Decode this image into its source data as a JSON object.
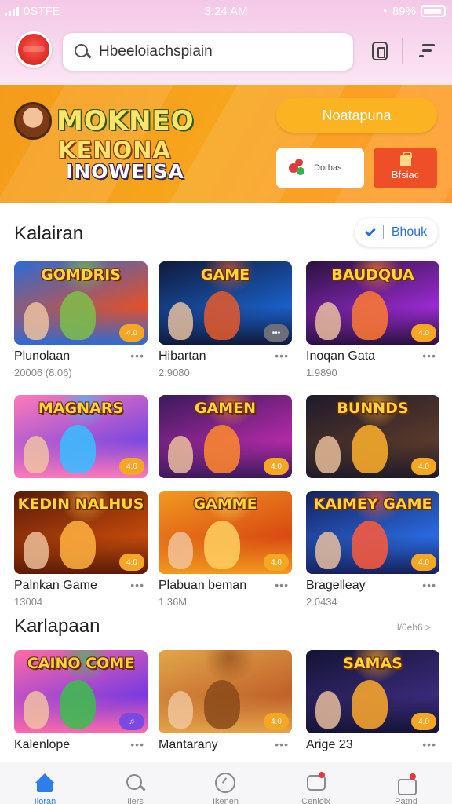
{
  "status_bar": {
    "carrier": "0STFE",
    "time": "3:24 AM",
    "battery": "89%"
  },
  "header": {
    "search": {
      "value": "Hbeeloiachspiain"
    }
  },
  "banner": {
    "title_line1": "MOKNEO",
    "title_line2": "KENONA",
    "title_line3": "INOWEISA",
    "cta_label": "Noatapuna",
    "chip_label": "Dorbas",
    "red_label": "Bfsiac"
  },
  "section1": {
    "title": "Kalairan",
    "follow_label": "Bhouk",
    "cards": [
      {
        "game_title": "GOMDRIS",
        "name": "Plunolaan",
        "meta": "20006 (8.06)",
        "badge": "4.0",
        "colors": [
          "#2c6bd6",
          "#e3502a",
          "#7bc04a"
        ]
      },
      {
        "game_title": "GAME",
        "name": "Hibartan",
        "meta": "2.9080",
        "badge": "•••",
        "colors": [
          "#101a3a",
          "#1a5fc7",
          "#e65a2a"
        ]
      },
      {
        "game_title": "BAUDQUA",
        "name": "Inoqan Gata",
        "meta": "1.9890",
        "badge": "4.0",
        "colors": [
          "#2a123e",
          "#9a2ad0",
          "#ff7a30"
        ]
      },
      {
        "game_title": "MAGNARS",
        "name": "",
        "meta": "",
        "badge": "4.0",
        "colors": [
          "#ff7ab8",
          "#7c48e0",
          "#36c0ff"
        ]
      },
      {
        "game_title": "GAMEN",
        "name": "",
        "meta": "",
        "badge": "4.0",
        "colors": [
          "#3a1a5a",
          "#b02aa6",
          "#ff8a2a"
        ]
      },
      {
        "game_title": "BUNNDS",
        "name": "",
        "meta": "",
        "badge": "4.0",
        "colors": [
          "#1e1a2a",
          "#5a3a2a",
          "#ffb02a"
        ]
      },
      {
        "game_title": "KEDIN NALHUS",
        "name": "Palnkan Game",
        "meta": "13004",
        "badge": "4.0",
        "colors": [
          "#5a1a08",
          "#c24a0a",
          "#ffb340"
        ]
      },
      {
        "game_title": "GAMME",
        "name": "Plabuan beman",
        "meta": "1.36M",
        "badge": "4.0",
        "colors": [
          "#f29a20",
          "#d84a12",
          "#ffd060"
        ]
      },
      {
        "game_title": "KAIMEY GAME",
        "name": "Bragelleay",
        "meta": "2.0434",
        "badge": "4.0",
        "colors": [
          "#16205a",
          "#2a6be0",
          "#ff5a3a"
        ]
      }
    ]
  },
  "section2": {
    "title": "Karlapaan",
    "see_all": "l/0eb6 >",
    "cards": [
      {
        "game_title": "CAINO COME",
        "name": "Kalenlope",
        "badge": "♫",
        "colors": [
          "#ff6aa8",
          "#7a3ae0",
          "#3ac04a"
        ]
      },
      {
        "game_title": "",
        "name": "Mantarany",
        "badge": "4.0",
        "colors": [
          "#e3a64a",
          "#c0612a",
          "#8a4a1a"
        ]
      },
      {
        "game_title": "SAMAS",
        "name": "Arige 23",
        "badge": "4.0",
        "colors": [
          "#141434",
          "#3a2a7a",
          "#ffaa2a"
        ]
      }
    ]
  },
  "bottom_nav": [
    {
      "label": "Iloran",
      "icon": "home-icon"
    },
    {
      "label": "Ilers",
      "icon": "search-icon"
    },
    {
      "label": "Ikenen",
      "icon": "clock-icon"
    },
    {
      "label": "Cenlolx",
      "icon": "chat-icon"
    },
    {
      "label": "Patnd",
      "icon": "bag-icon"
    }
  ],
  "colors": {
    "accent": "#2d7ee8",
    "banner": "#f7a51c",
    "badge": "#f5a623"
  }
}
